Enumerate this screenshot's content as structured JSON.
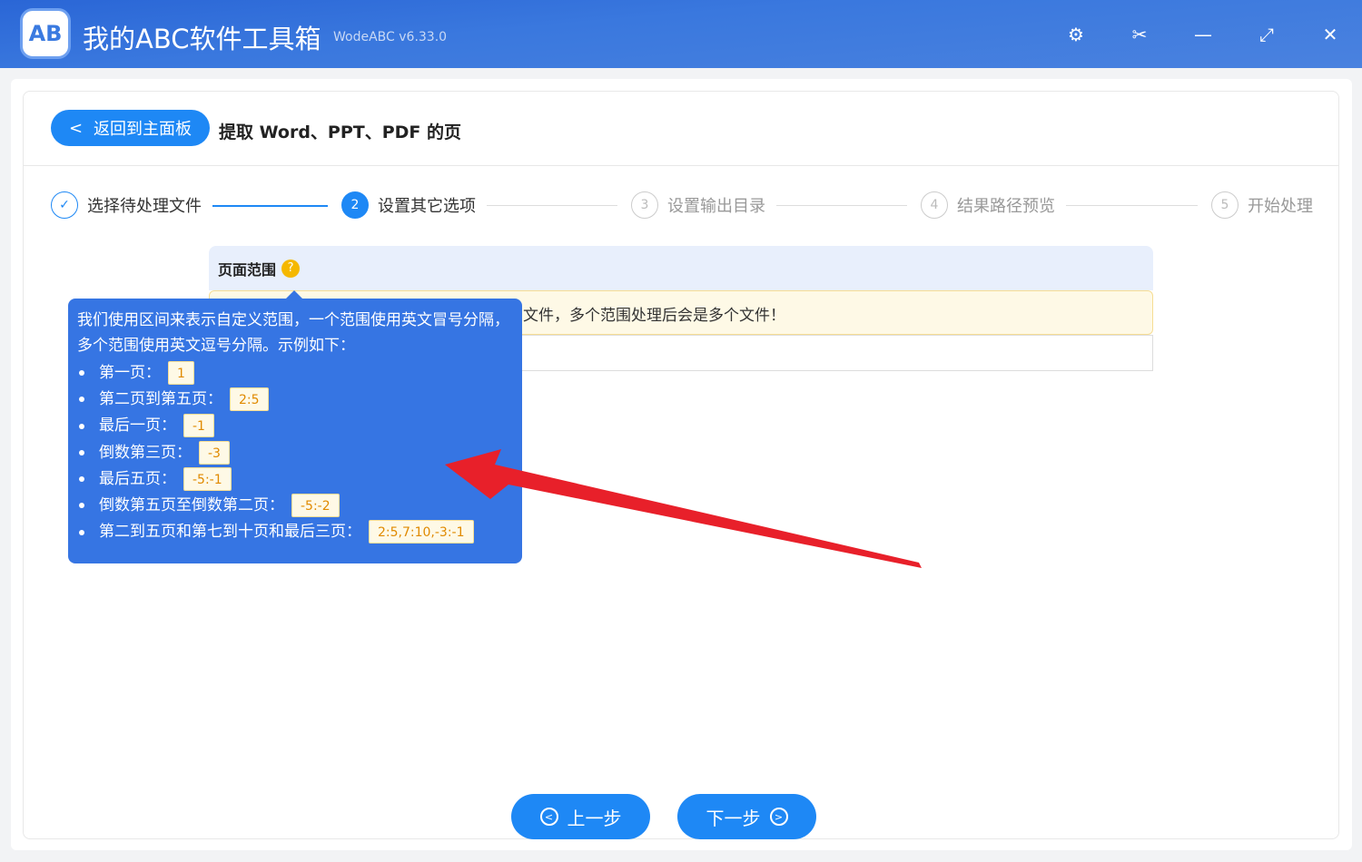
{
  "app": {
    "title": "我的ABC软件工具箱",
    "version": "WodeABC v6.33.0",
    "logo": "AB"
  },
  "window": {
    "settings": "⚙",
    "scissors": "✂",
    "minimize": "—",
    "maximize": "⤢",
    "close": "✕"
  },
  "header": {
    "back_label": "返回到主面板",
    "page_title": "提取 Word、PPT、PDF 的页"
  },
  "steps": [
    {
      "num": "✓",
      "label": "选择待处理文件"
    },
    {
      "num": "2",
      "label": "设置其它选项"
    },
    {
      "num": "3",
      "label": "设置输出目录"
    },
    {
      "num": "4",
      "label": "结果路径预览"
    },
    {
      "num": "5",
      "label": "开始处理"
    }
  ],
  "section": {
    "title": "页面范围",
    "help": "?",
    "notice_visible": "文件，多个范围处理后会是多个文件！",
    "input_value": ""
  },
  "tooltip": {
    "intro": "我们使用区间来表示自定义范围，一个范围使用英文冒号分隔，多个范围使用英文逗号分隔。示例如下：",
    "examples": [
      {
        "label": "第一页：",
        "code": "1"
      },
      {
        "label": "第二页到第五页：",
        "code": "2:5"
      },
      {
        "label": "最后一页：",
        "code": "-1"
      },
      {
        "label": "倒数第三页：",
        "code": "-3"
      },
      {
        "label": "最后五页：",
        "code": "-5:-1"
      },
      {
        "label": "倒数第五页至倒数第二页：",
        "code": "-5:-2"
      },
      {
        "label": "第二到五页和第七到十页和最后三页：",
        "code": "2:5,7:10,-3:-1"
      }
    ]
  },
  "footer": {
    "prev": "上一步",
    "next": "下一步"
  },
  "colors": {
    "accent": "#1e88f5",
    "arrow": "#e8202a"
  }
}
